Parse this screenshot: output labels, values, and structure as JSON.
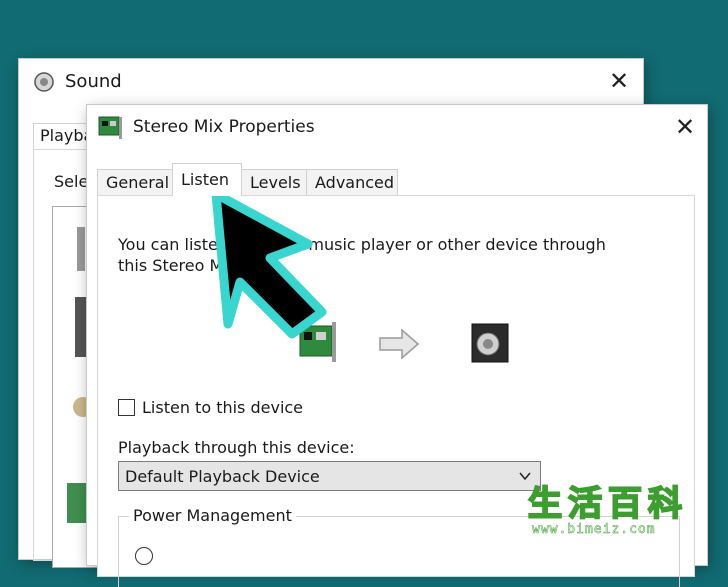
{
  "sound_window": {
    "title": "Sound",
    "tab_partial": "Playba",
    "select_partial": "Sele"
  },
  "props_window": {
    "title": "Stereo Mix  Properties",
    "tabs": [
      {
        "label": "General",
        "active": false
      },
      {
        "label": "Listen",
        "active": true
      },
      {
        "label": "Levels",
        "active": false
      },
      {
        "label": "Advanced",
        "active": false
      }
    ],
    "description_line1": "You can liste            ble music player or other device through",
    "description_line2": "this  Stereo M",
    "listen_checkbox": {
      "label": "Listen to this device",
      "checked": false
    },
    "playback_label": "Playback through this device:",
    "playback_dropdown": {
      "value": "Default Playback Device"
    },
    "power_group_title": "Power Management"
  },
  "annotation": {
    "arrow_color": "#39d5cf"
  },
  "watermark": {
    "chars": [
      "生",
      "活",
      "百",
      "科"
    ],
    "url": "www.bimeiz.com"
  },
  "colors": {
    "background": "#116b72",
    "window": "#ffffff"
  }
}
